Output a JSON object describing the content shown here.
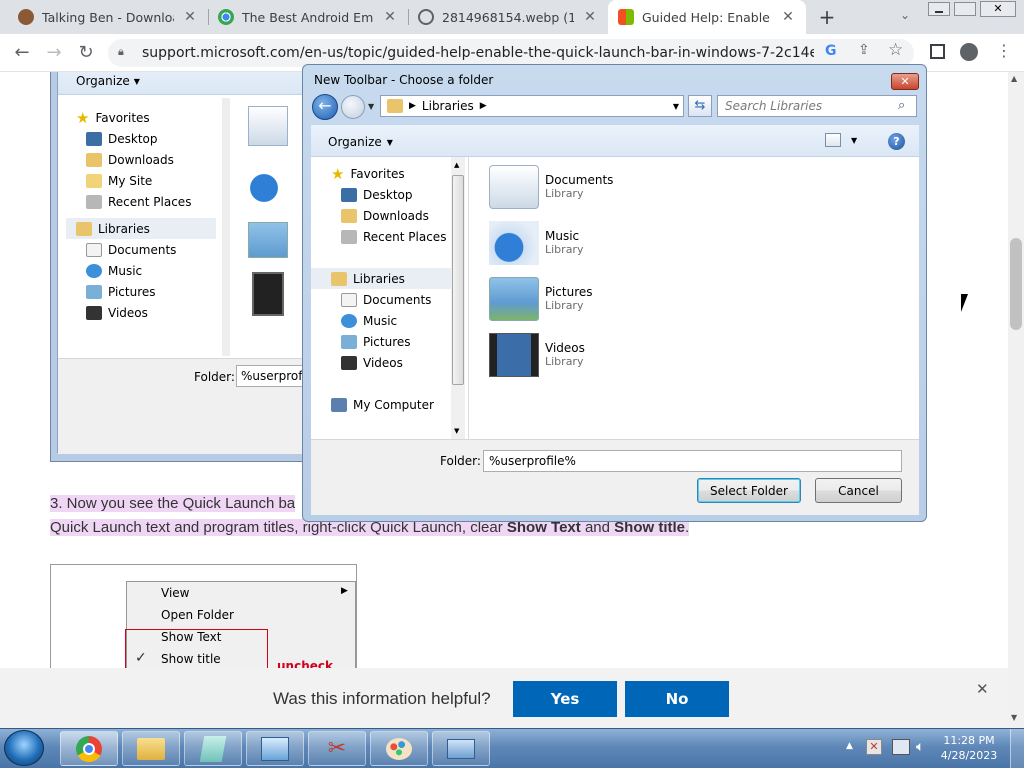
{
  "tabs": [
    {
      "title": "Talking Ben - Download",
      "favicon": "talking-ben-icon"
    },
    {
      "title": "The Best Android Emulato",
      "favicon": "chrome-icon"
    },
    {
      "title": "2814968154.webp (1020×",
      "favicon": "globe-icon"
    },
    {
      "title": "Guided Help: Enable the Q",
      "favicon": "microsoft-icon"
    }
  ],
  "address": {
    "url": "support.microsoft.com/en-us/topic/guided-help-enable-the-quick-launch-bar-in-windows-7-2c14e2ba-67..."
  },
  "bg_dialog": {
    "organize": "Organize",
    "favorites": "Favorites",
    "fav_items": [
      "Desktop",
      "Downloads",
      "My Site",
      "Recent Places"
    ],
    "libraries": "Libraries",
    "lib_items": [
      "Documents",
      "Music",
      "Pictures",
      "Videos"
    ],
    "folder_label": "Folder:",
    "folder_value": "%userprofile"
  },
  "dialog": {
    "title": "New Toolbar - Choose a folder",
    "breadcrumb": "Libraries",
    "search_placeholder": "Search Libraries",
    "organize": "Organize",
    "favorites": "Favorites",
    "fav_items": [
      "Desktop",
      "Downloads",
      "Recent Places"
    ],
    "libraries": "Libraries",
    "lib_items": [
      "Documents",
      "Music",
      "Pictures",
      "Videos"
    ],
    "computer": "My Computer",
    "libraries_list": [
      {
        "name": "Documents",
        "type": "Library"
      },
      {
        "name": "Music",
        "type": "Library"
      },
      {
        "name": "Pictures",
        "type": "Library"
      },
      {
        "name": "Videos",
        "type": "Library"
      }
    ],
    "folder_label": "Folder:",
    "folder_value": "%userprofile%",
    "select_button": "Select Folder",
    "cancel_button": "Cancel"
  },
  "article": {
    "step_a": "3. Now you see the Quick Launch ba",
    "step_b1": "Quick Launch text and program titles, right-click Quick Launch, clear ",
    "step_b2": "Show Text",
    "step_b3": " and ",
    "step_b4": "Show title",
    "step_b5": "."
  },
  "context_menu": {
    "items": [
      "View",
      "Open Folder",
      "Show Text",
      "Show title"
    ],
    "uncheck_label": "uncheck"
  },
  "feedback": {
    "question": "Was this information helpful?",
    "yes": "Yes",
    "no": "No"
  },
  "clock": {
    "time": "11:28 PM",
    "date": "4/28/2023"
  },
  "colors": {
    "ms_blue": "#0067b8",
    "highlight": "#f0d6f5",
    "chrome_tab_bg": "#dee1e6"
  }
}
